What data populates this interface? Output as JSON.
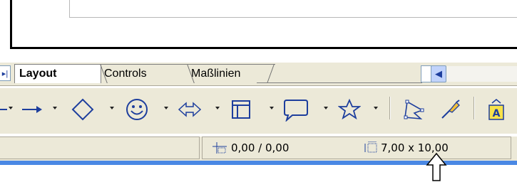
{
  "tabs": [
    {
      "label": "Layout",
      "active": true
    },
    {
      "label": "Controls",
      "active": false
    },
    {
      "label": "Maßlinien",
      "active": false
    }
  ],
  "toolbar": {
    "items": [
      "line-icon",
      "arrow-icon",
      "diamond-icon",
      "smiley-icon",
      "double-arrow-icon",
      "flowchart-icon",
      "callout-icon",
      "star-icon",
      "points-icon",
      "glue-points-icon",
      "fontwork-icon"
    ]
  },
  "status": {
    "position": "0,00 / 0,00",
    "size": "7,00 x 10,00"
  },
  "colors": {
    "accent": "#4a88e4",
    "chrome": "#ece9d8",
    "icon": "#1d3e9d"
  }
}
